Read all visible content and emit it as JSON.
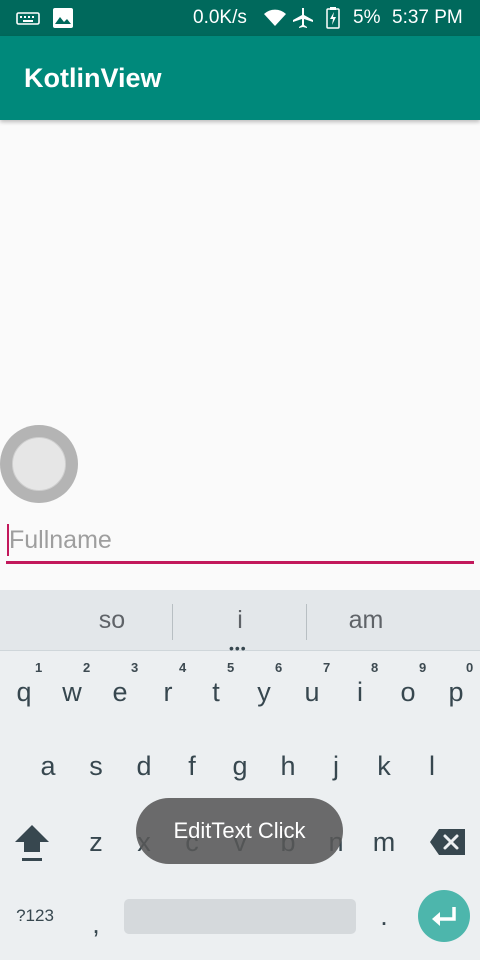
{
  "status_bar": {
    "left_icons": [
      "keyboard-icon",
      "image-icon"
    ],
    "speed": "0.0K/s",
    "battery": "5%",
    "time": "5:37 PM",
    "right_icons": [
      "wifi-icon",
      "airplane-icon",
      "battery-charging-icon"
    ]
  },
  "app_bar": {
    "title": "KotlinView"
  },
  "form": {
    "fullname_placeholder": "Fullname"
  },
  "keyboard": {
    "suggestions": [
      "so",
      "i",
      "am"
    ],
    "suggestion_more": "•••",
    "row1": [
      {
        "key": "q",
        "hint": "1"
      },
      {
        "key": "w",
        "hint": "2"
      },
      {
        "key": "e",
        "hint": "3"
      },
      {
        "key": "r",
        "hint": "4"
      },
      {
        "key": "t",
        "hint": "5"
      },
      {
        "key": "y",
        "hint": "6"
      },
      {
        "key": "u",
        "hint": "7"
      },
      {
        "key": "i",
        "hint": "8"
      },
      {
        "key": "o",
        "hint": "9"
      },
      {
        "key": "p",
        "hint": "0"
      }
    ],
    "row2": [
      "a",
      "s",
      "d",
      "f",
      "g",
      "h",
      "j",
      "k",
      "l"
    ],
    "row3": [
      "z",
      "x",
      "c",
      "v",
      "b",
      "n",
      "m"
    ],
    "symbols_key": "?123",
    "comma_key": ",",
    "period_key": "."
  },
  "toast": {
    "text": "EditText Click"
  },
  "colors": {
    "primary": "#00897b",
    "primary_dark": "#00695c",
    "accent": "#c2185b",
    "enter_key": "#4db6ac"
  }
}
